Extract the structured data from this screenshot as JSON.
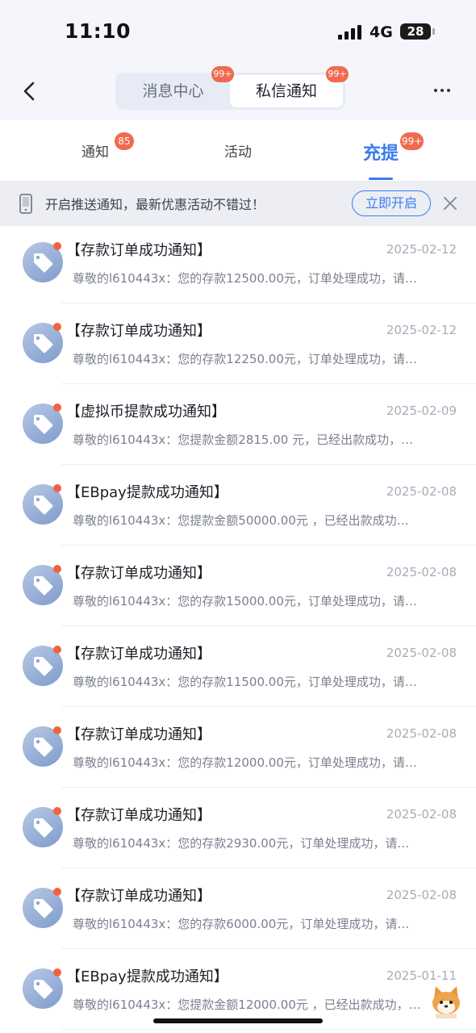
{
  "status": {
    "time": "11:10",
    "network": "4G",
    "battery": "28"
  },
  "header": {
    "segments": [
      {
        "label": "消息中心",
        "badge": "99+"
      },
      {
        "label": "私信通知",
        "badge": "99+"
      }
    ]
  },
  "tabs": [
    {
      "label": "通知",
      "badge": "85"
    },
    {
      "label": "活动",
      "badge": ""
    },
    {
      "label": "充提",
      "badge": "99+"
    }
  ],
  "banner": {
    "text": "开启推送通知，最新优惠活动不错过！",
    "button": "立即开启"
  },
  "messages": [
    {
      "title": "【存款订单成功通知】",
      "date": "2025-02-12",
      "preview": "尊敬的l610443x：您的存款12500.00元，订单处理成功，请…"
    },
    {
      "title": "【存款订单成功通知】",
      "date": "2025-02-12",
      "preview": "尊敬的l610443x：您的存款12250.00元，订单处理成功，请…"
    },
    {
      "title": "【虚拟币提款成功通知】",
      "date": "2025-02-09",
      "preview": "尊敬的l610443x：您提款金额2815.00 元，已经出款成功，…"
    },
    {
      "title": "【EBpay提款成功通知】",
      "date": "2025-02-08",
      "preview": "尊敬的l610443x：您提款金额50000.00元 ，已经出款成功…"
    },
    {
      "title": "【存款订单成功通知】",
      "date": "2025-02-08",
      "preview": "尊敬的l610443x：您的存款15000.00元，订单处理成功，请…"
    },
    {
      "title": "【存款订单成功通知】",
      "date": "2025-02-08",
      "preview": "尊敬的l610443x：您的存款11500.00元，订单处理成功，请…"
    },
    {
      "title": "【存款订单成功通知】",
      "date": "2025-02-08",
      "preview": "尊敬的l610443x：您的存款12000.00元，订单处理成功，请…"
    },
    {
      "title": "【存款订单成功通知】",
      "date": "2025-02-08",
      "preview": "尊敬的l610443x：您的存款2930.00元，订单处理成功，请…"
    },
    {
      "title": "【存款订单成功通知】",
      "date": "2025-02-08",
      "preview": "尊敬的l610443x：您的存款6000.00元，订单处理成功，请…"
    },
    {
      "title": "【EBpay提款成功通知】",
      "date": "2025-01-11",
      "preview": "尊敬的l610443x：您提款金额12000.00元 ，已经出款成功，…"
    }
  ],
  "colors": {
    "accent": "#3a7bf2",
    "badge": "#f06a4f",
    "unread_dot": "#f2623f"
  }
}
